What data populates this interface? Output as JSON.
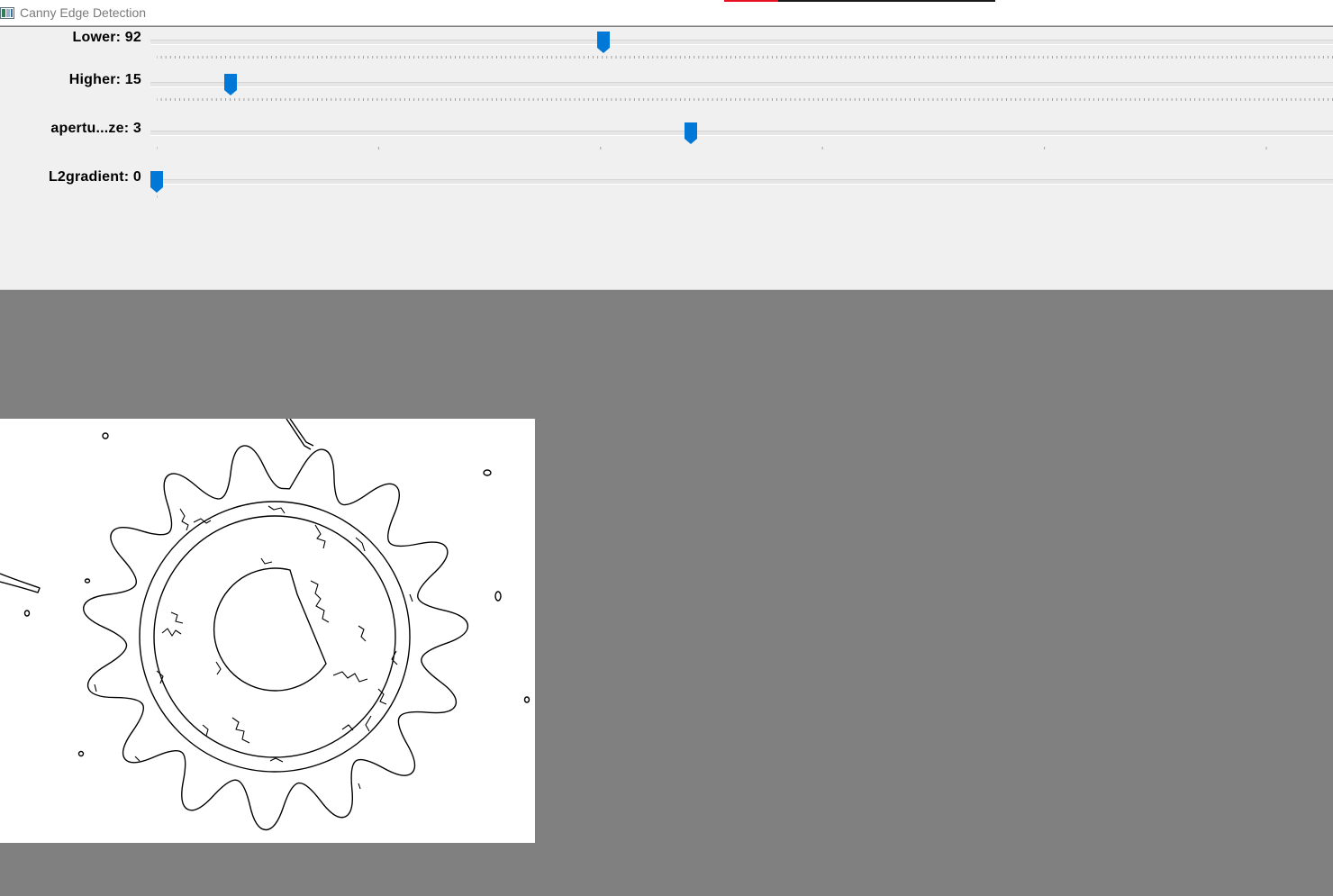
{
  "window": {
    "title": "Canny Edge Detection",
    "accent_color": "#0078d7"
  },
  "trackbars": [
    {
      "label": "Lower: 92",
      "value": 92,
      "max": 255,
      "fraction": 0.4745
    },
    {
      "label": "Higher: 15",
      "value": 15,
      "max": 255,
      "fraction": 0.0784
    },
    {
      "label": "apertu...ze: 3",
      "value": 3,
      "max": 5,
      "fraction": 0.567
    },
    {
      "label": "L2gradient: 0",
      "value": 0,
      "max": 1,
      "fraction": 0.0
    }
  ],
  "image": {
    "description_icon": "edge-image",
    "background": "#ffffff",
    "stroke": "#000000"
  }
}
